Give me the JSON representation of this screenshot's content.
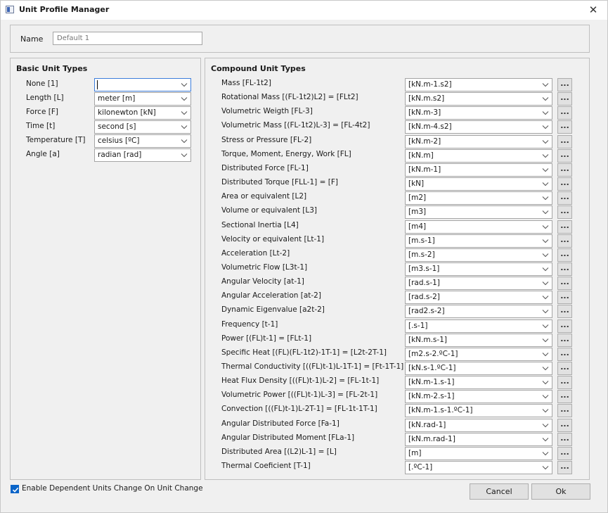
{
  "window": {
    "title": "Unit Profile Manager",
    "close_glyph": "✕",
    "icon": "app-window-icon"
  },
  "name_field": {
    "label": "Name",
    "placeholder": "Default 1",
    "value": ""
  },
  "basic": {
    "title": "Basic Unit Types",
    "rows": [
      {
        "label": "None  [1]",
        "value": ""
      },
      {
        "label": "Length  [L]",
        "value": "meter [m]"
      },
      {
        "label": "Force  [F]",
        "value": "kilonewton [kN]"
      },
      {
        "label": "Time  [t]",
        "value": "second [s]"
      },
      {
        "label": "Temperature  [T]",
        "value": "celsius [ºC]"
      },
      {
        "label": "Angle  [a]",
        "value": "radian [rad]"
      }
    ]
  },
  "compound": {
    "title": "Compound Unit Types",
    "button_label": "...",
    "rows": [
      {
        "label": "Mass  [FL-1t2]",
        "value": "[kN.m-1.s2]"
      },
      {
        "label": "Rotational Mass  [(FL-1t2)L2]  =  [FLt2]",
        "value": "[kN.m.s2]"
      },
      {
        "label": "Volumetric Weigth  [FL-3]",
        "value": "[kN.m-3]"
      },
      {
        "label": "Volumetric Mass  [(FL-1t2)L-3]  =  [FL-4t2]",
        "value": "[kN.m-4.s2]"
      },
      {
        "label": "Stress or Pressure  [FL-2]",
        "value": "[kN.m-2]"
      },
      {
        "label": "Torque, Moment, Energy, Work  [FL]",
        "value": "[kN.m]"
      },
      {
        "label": "Distributed Force  [FL-1]",
        "value": "[kN.m-1]"
      },
      {
        "label": "Distributed Torque  [FLL-1]  =  [F]",
        "value": "[kN]"
      },
      {
        "label": "Area or equivalent  [L2]",
        "value": "[m2]"
      },
      {
        "label": "Volume or equivalent  [L3]",
        "value": "[m3]"
      },
      {
        "label": "Sectional Inertia  [L4]",
        "value": "[m4]"
      },
      {
        "label": "Velocity or equivalent  [Lt-1]",
        "value": "[m.s-1]"
      },
      {
        "label": "Acceleration  [Lt-2]",
        "value": "[m.s-2]"
      },
      {
        "label": "Volumetric Flow  [L3t-1]",
        "value": "[m3.s-1]"
      },
      {
        "label": "Angular Velocity  [at-1]",
        "value": "[rad.s-1]"
      },
      {
        "label": "Angular Acceleration  [at-2]",
        "value": "[rad.s-2]"
      },
      {
        "label": "Dynamic Eigenvalue  [a2t-2]",
        "value": "[rad2.s-2]"
      },
      {
        "label": "Frequency  [t-1]",
        "value": "[.s-1]"
      },
      {
        "label": "Power  [(FL)t-1]  =  [FLt-1]",
        "value": "[kN.m.s-1]"
      },
      {
        "label": "Specific Heat  [(FL)(FL-1t2)-1T-1]  =  [L2t-2T-1]",
        "value": "[m2.s-2.ºC-1]"
      },
      {
        "label": "Thermal Conductivity  [((FL)t-1)L-1T-1]  =  [Ft-1T-1]",
        "value": "[kN.s-1.ºC-1]"
      },
      {
        "label": "Heat Flux Density  [((FL)t-1)L-2]  =  [FL-1t-1]",
        "value": "[kN.m-1.s-1]"
      },
      {
        "label": "Volumetric Power  [((FL)t-1)L-3]  =  [FL-2t-1]",
        "value": "[kN.m-2.s-1]"
      },
      {
        "label": "Convection  [((FL)t-1)L-2T-1]  =  [FL-1t-1T-1]",
        "value": "[kN.m-1.s-1.ºC-1]"
      },
      {
        "label": "Angular Distributed Force  [Fa-1]",
        "value": "[kN.rad-1]"
      },
      {
        "label": "Angular Distributed Moment  [FLa-1]",
        "value": "[kN.m.rad-1]"
      },
      {
        "label": "Distributed Area  [(L2)L-1]  =  [L]",
        "value": "[m]"
      },
      {
        "label": "Thermal Coeficient  [T-1]",
        "value": "[.ºC-1]"
      }
    ]
  },
  "footer": {
    "checkbox_label": "Enable Dependent Units Change On Unit Change",
    "checkbox_checked": true,
    "cancel_label": "Cancel",
    "ok_label": "Ok"
  },
  "colors": {
    "accent": "#0a64c8",
    "focus_border": "#3d7edb",
    "panel_bg": "#f0f0f0"
  }
}
